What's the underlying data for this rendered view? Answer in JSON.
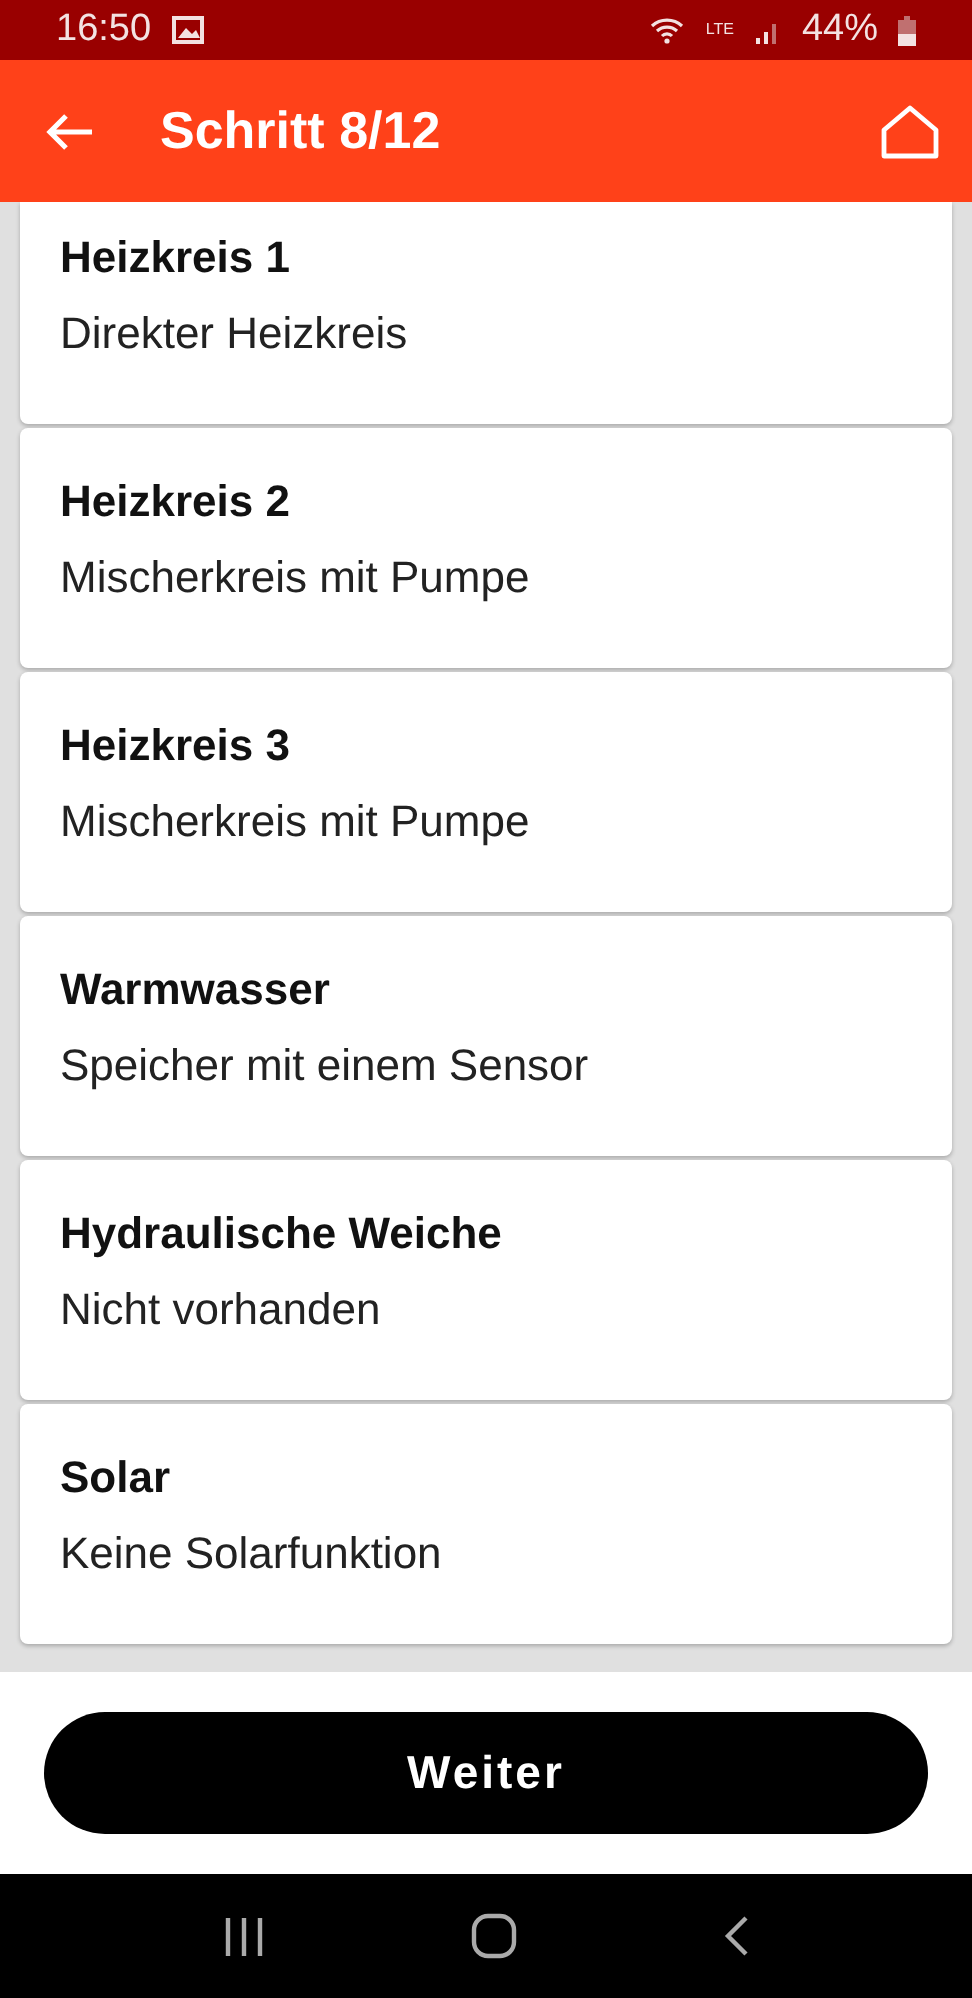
{
  "status_bar": {
    "time": "16:50",
    "network": "LTE",
    "battery": "44%"
  },
  "app_bar": {
    "title": "Schritt 8/12"
  },
  "items": [
    {
      "title": "Heizkreis 1",
      "value": "Direkter Heizkreis"
    },
    {
      "title": "Heizkreis 2",
      "value": "Mischerkreis mit Pumpe"
    },
    {
      "title": "Heizkreis 3",
      "value": "Mischerkreis mit Pumpe"
    },
    {
      "title": "Warmwasser",
      "value": "Speicher mit einem Sensor"
    },
    {
      "title": "Hydraulische Weiche",
      "value": "Nicht vorhanden"
    },
    {
      "title": "Solar",
      "value": "Keine Solarfunktion"
    }
  ],
  "primary_button": "Weiter"
}
